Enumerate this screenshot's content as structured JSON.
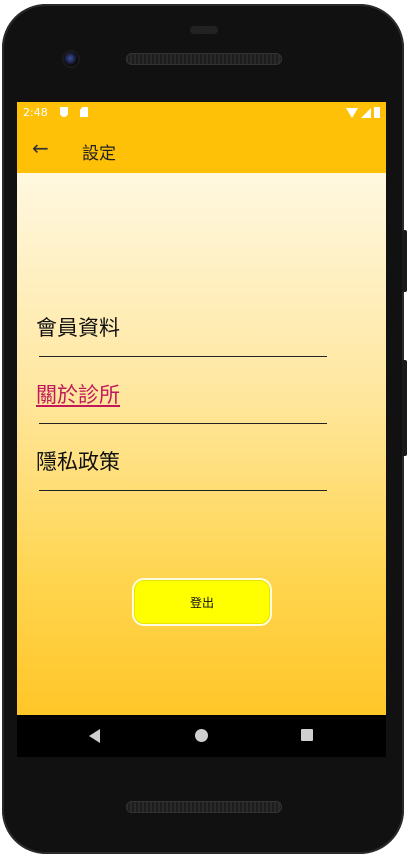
{
  "status_bar": {
    "time": "2:48",
    "icons": [
      "shield-icon",
      "sd-card-icon",
      "wifi-icon",
      "signal-icon",
      "battery-icon"
    ]
  },
  "app_bar": {
    "back_icon": "arrow-left-icon",
    "title": "設定",
    "color": "#ffc107"
  },
  "menu": {
    "items": [
      {
        "label": "會員資料"
      },
      {
        "label": "關於診所"
      },
      {
        "label": "隱私政策"
      }
    ]
  },
  "logout_button": {
    "label": "登出",
    "color": "#ffff00"
  },
  "nav_bar": {
    "icons": [
      "back-triangle-icon",
      "home-circle-icon",
      "recents-square-icon"
    ]
  }
}
